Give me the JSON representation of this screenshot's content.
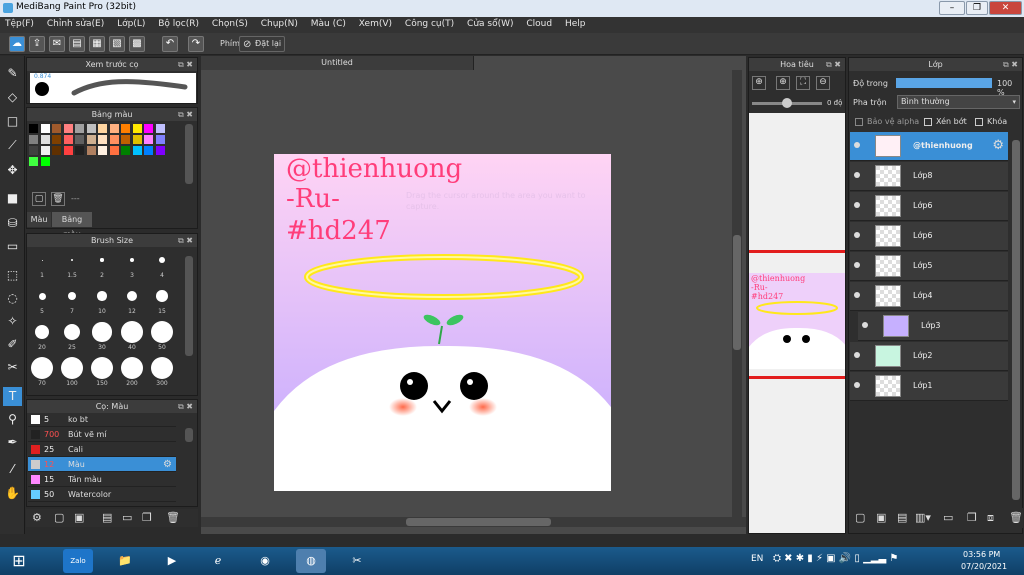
{
  "window": {
    "title": "MediBang Paint Pro (32bit)"
  },
  "menu": [
    "Tệp(F)",
    "Chỉnh sửa(E)",
    "Lớp(L)",
    "Bộ lọc(R)",
    "Chọn(S)",
    "Chụp(N)",
    "Màu (C)",
    "Xem(V)",
    "Công cụ(T)",
    "Cửa sổ(W)",
    "Cloud",
    "Help"
  ],
  "toolbar": {
    "finger_label": "Phím",
    "reset_label": "Đặt lại"
  },
  "panels": {
    "brush_preview": {
      "title": "Xem trước cọ",
      "size_value": "0.874"
    },
    "color_palette": {
      "title": "Bảng màu",
      "tab_color": "Màu",
      "tab_palette": "Bảng màu",
      "extra": "---"
    },
    "brush_size": {
      "title": "Brush Size",
      "labels": [
        "1",
        "1.5",
        "2",
        "3",
        "4",
        "5",
        "7",
        "10",
        "12",
        "15",
        "20",
        "25",
        "30",
        "40",
        "50",
        "70",
        "100",
        "150",
        "200",
        "300"
      ]
    },
    "brush_list": {
      "title": "Cọ: Màu",
      "items": [
        {
          "num": "5",
          "name": "ko bt",
          "color": "#ffffff"
        },
        {
          "num": "700",
          "name": "Bút vẽ mí",
          "color": "#222222"
        },
        {
          "num": "25",
          "name": "Cali",
          "color": "#e02020"
        },
        {
          "num": "12",
          "name": "Màu",
          "color": "#cccccc"
        },
        {
          "num": "15",
          "name": "Tán màu",
          "color": "#ff88ff"
        },
        {
          "num": "50",
          "name": "Watercolor",
          "color": "#66ccff"
        }
      ]
    },
    "navigator": {
      "title": "Hoa tiêu",
      "angle": "0 độ"
    },
    "layers": {
      "title": "Lớp",
      "opacity_label": "Độ trong",
      "opacity_value": "100 %",
      "blend_label": "Pha trộn",
      "blend_value": "Bình thường",
      "protect_alpha": "Bảo vệ alpha",
      "clipping": "Xén bớt",
      "lock": "Khóa",
      "items": [
        {
          "name": "@thienhuong",
          "selected": true
        },
        {
          "name": "Lớp8",
          "selected": false
        },
        {
          "name": "Lớp6",
          "selected": false
        },
        {
          "name": "Lớp6",
          "selected": false
        },
        {
          "name": "Lớp5",
          "selected": false
        },
        {
          "name": "Lớp4",
          "selected": false
        },
        {
          "name": "Lớp3",
          "selected": false
        },
        {
          "name": "Lớp2",
          "selected": false
        },
        {
          "name": "Lớp1",
          "selected": false
        }
      ]
    }
  },
  "canvas": {
    "tab_title": "Untitled",
    "watermark_lines": [
      "@thienhuong",
      "-Ru-",
      "#hd247"
    ],
    "ghost_text": "Drag the cursor around the area you want to capture."
  },
  "taskbar": {
    "lang": "EN",
    "time": "03:56 PM",
    "date": "07/20/2021",
    "zalo": "Zalo"
  },
  "colors": {
    "accent": "#3a8fd6",
    "watermark": "#ff3d7a",
    "halo": "#ffe81a"
  }
}
